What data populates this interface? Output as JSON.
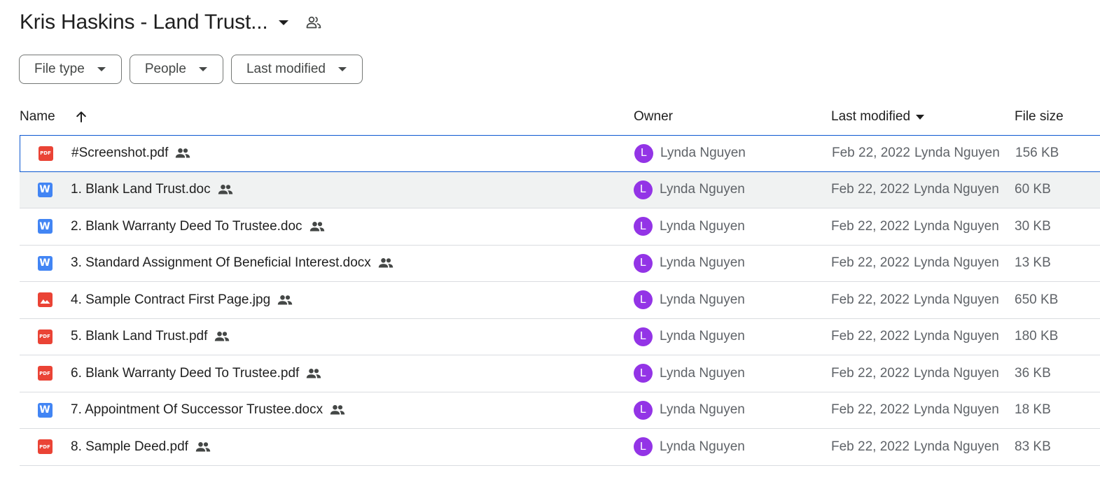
{
  "header": {
    "title": "Kris Haskins - Land Trust...",
    "title_caret_icon": "arrow-drop-down-icon",
    "shared_icon": "shared-folder-people-icon"
  },
  "filters": [
    {
      "label": "File type"
    },
    {
      "label": "People"
    },
    {
      "label": "Last modified"
    }
  ],
  "columns": {
    "name": "Name",
    "owner": "Owner",
    "last_modified": "Last modified",
    "file_size": "File size",
    "sort_icon": "arrow-upward-icon"
  },
  "colors": {
    "accent": "#0b57d0",
    "avatar": "#9334e6",
    "pdf": "#ea4335",
    "word": "#4285f4",
    "image": "#ea4335"
  },
  "files": [
    {
      "name": "#Screenshot.pdf",
      "type": "pdf",
      "icon": "pdf-icon",
      "owner_initial": "L",
      "owner": "Lynda Nguyen",
      "modified_date": "Feb 22, 2022",
      "modified_by": "Lynda Nguyen",
      "size": "156 KB",
      "state": "selected"
    },
    {
      "name": "1. Blank Land Trust.doc",
      "type": "word",
      "icon": "word-icon",
      "owner_initial": "L",
      "owner": "Lynda Nguyen",
      "modified_date": "Feb 22, 2022",
      "modified_by": "Lynda Nguyen",
      "size": "60 KB",
      "state": "hovered"
    },
    {
      "name": "2. Blank Warranty Deed To Trustee.doc",
      "type": "word",
      "icon": "word-icon",
      "owner_initial": "L",
      "owner": "Lynda Nguyen",
      "modified_date": "Feb 22, 2022",
      "modified_by": "Lynda Nguyen",
      "size": "30 KB",
      "state": ""
    },
    {
      "name": "3. Standard Assignment Of Beneficial Interest.docx",
      "type": "word",
      "icon": "word-icon",
      "owner_initial": "L",
      "owner": "Lynda Nguyen",
      "modified_date": "Feb 22, 2022",
      "modified_by": "Lynda Nguyen",
      "size": "13 KB",
      "state": ""
    },
    {
      "name": "4. Sample Contract First Page.jpg",
      "type": "image",
      "icon": "image-icon",
      "owner_initial": "L",
      "owner": "Lynda Nguyen",
      "modified_date": "Feb 22, 2022",
      "modified_by": "Lynda Nguyen",
      "size": "650 KB",
      "state": ""
    },
    {
      "name": "5. Blank Land Trust.pdf",
      "type": "pdf",
      "icon": "pdf-icon",
      "owner_initial": "L",
      "owner": "Lynda Nguyen",
      "modified_date": "Feb 22, 2022",
      "modified_by": "Lynda Nguyen",
      "size": "180 KB",
      "state": ""
    },
    {
      "name": "6. Blank Warranty Deed To Trustee.pdf",
      "type": "pdf",
      "icon": "pdf-icon",
      "owner_initial": "L",
      "owner": "Lynda Nguyen",
      "modified_date": "Feb 22, 2022",
      "modified_by": "Lynda Nguyen",
      "size": "36 KB",
      "state": ""
    },
    {
      "name": "7. Appointment Of Successor Trustee.docx",
      "type": "word",
      "icon": "word-icon",
      "owner_initial": "L",
      "owner": "Lynda Nguyen",
      "modified_date": "Feb 22, 2022",
      "modified_by": "Lynda Nguyen",
      "size": "18 KB",
      "state": ""
    },
    {
      "name": "8. Sample Deed.pdf",
      "type": "pdf",
      "icon": "pdf-icon",
      "owner_initial": "L",
      "owner": "Lynda Nguyen",
      "modified_date": "Feb 22, 2022",
      "modified_by": "Lynda Nguyen",
      "size": "83 KB",
      "state": ""
    }
  ]
}
